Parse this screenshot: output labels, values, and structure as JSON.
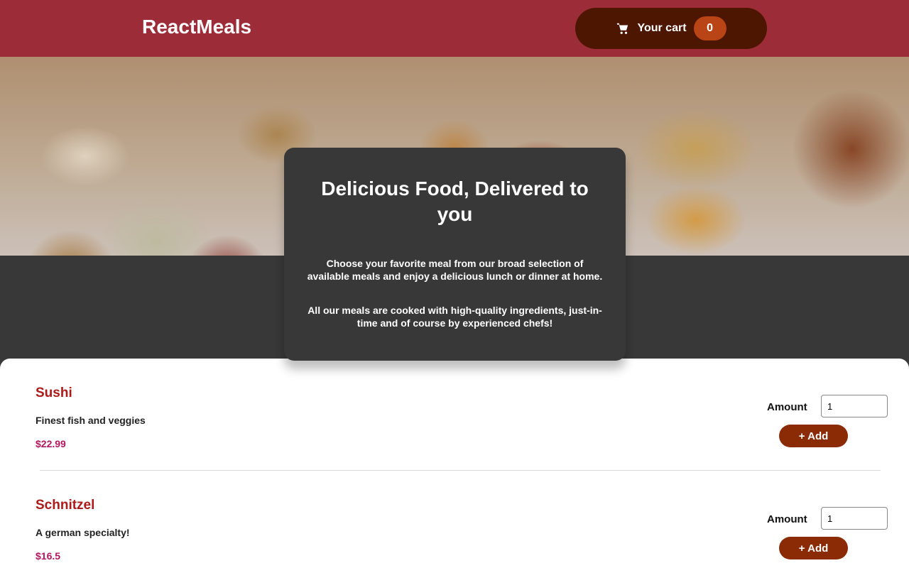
{
  "header": {
    "logo": "ReactMeals",
    "cart_label": "Your cart",
    "cart_count": "0"
  },
  "summary": {
    "title": "Delicious Food, Delivered to you",
    "paragraph1": "Choose your favorite meal from our broad selection of available meals and enjoy a delicious lunch or dinner at home.",
    "paragraph2": "All our meals are cooked with high-quality ingredients, just-in-time and of course by experienced chefs!"
  },
  "meals": [
    {
      "name": "Sushi",
      "description": "Finest fish and veggies",
      "price": "$22.99",
      "amount_label": "Amount",
      "amount_value": "1",
      "add_label": "+ Add"
    },
    {
      "name": "Schnitzel",
      "description": "A german specialty!",
      "price": "$16.5",
      "amount_label": "Amount",
      "amount_value": "1",
      "add_label": "+ Add"
    }
  ],
  "colors": {
    "header_bg": "#9d2c39",
    "cart_button_bg": "#4d1601",
    "badge_bg": "#b94517",
    "meal_name": "#ad1a1a",
    "price": "#b3185f",
    "add_button_bg": "#8a2b06"
  },
  "icons": {
    "cart": "cart-icon"
  }
}
